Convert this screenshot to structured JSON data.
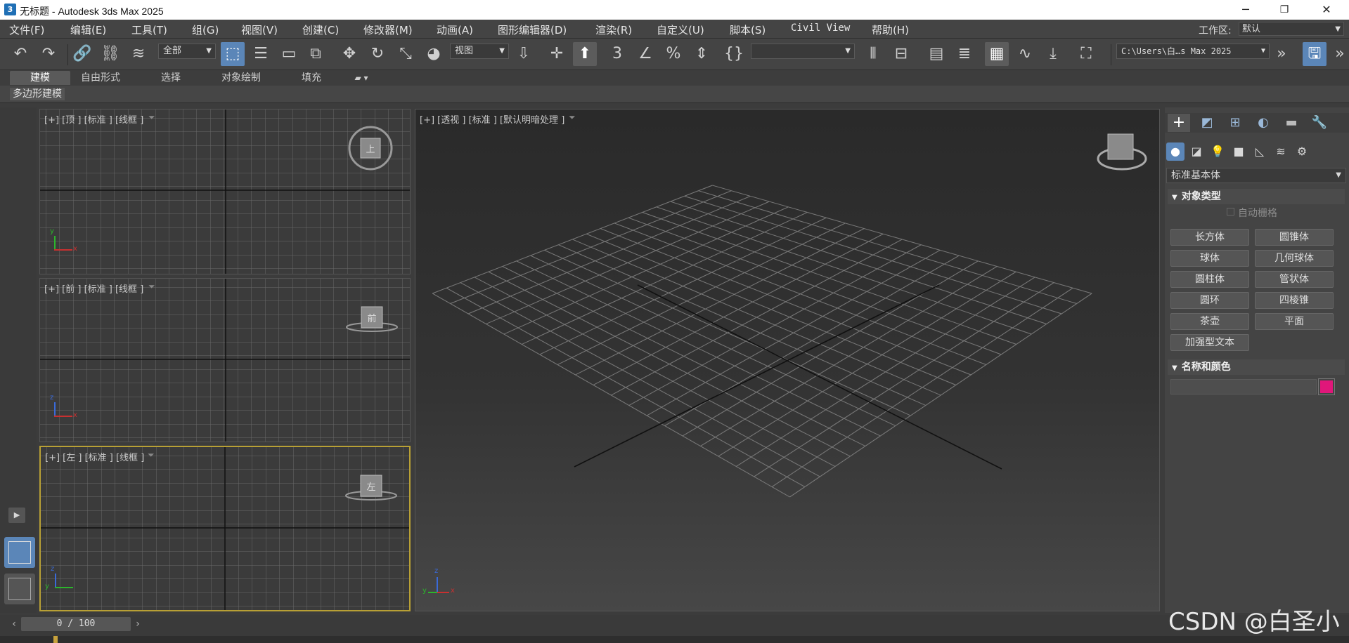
{
  "titlebar": {
    "app_icon_text": "3",
    "title": "无标题 - Autodesk 3ds Max 2025",
    "minimize": "─",
    "restore": "❐",
    "close": "✕"
  },
  "menubar": {
    "items": [
      "文件(F)",
      "编辑(E)",
      "工具(T)",
      "组(G)",
      "视图(V)",
      "创建(C)",
      "修改器(M)",
      "动画(A)",
      "图形编辑器(D)",
      "渲染(R)",
      "自定义(U)",
      "脚本(S)",
      "Civil View",
      "帮助(H)"
    ],
    "workspace_label": "工作区:",
    "workspace_value": "默认"
  },
  "toolbar": {
    "selection_filter": "全部",
    "coord_system": "视图",
    "named_selection": "",
    "project_path": "C:\\Users\\白…s Max 2025"
  },
  "ribbon": {
    "tabs": [
      "建模",
      "自由形式",
      "选择",
      "对象绘制",
      "填充"
    ],
    "selected_tab": "建模",
    "panel_label": "多边形建模"
  },
  "viewports": {
    "top": {
      "label": "[+] [顶 ] [标准 ] [线框 ]",
      "cube_text": "上"
    },
    "front": {
      "label": "[+] [前 ] [标准 ] [线框 ]",
      "cube_text": "前"
    },
    "left": {
      "label": "[+] [左 ] [标准 ] [线框 ]",
      "cube_text": "左"
    },
    "perspective": {
      "label": "[+] [透视 ] [标准 ] [默认明暗处理 ]"
    },
    "axis_x": "x",
    "axis_y": "y",
    "axis_z": "z"
  },
  "command_panel": {
    "category_dropdown": "标准基本体",
    "object_type": {
      "title": "对象类型",
      "autogrid_label": "自动栅格",
      "buttons": [
        "长方体",
        "圆锥体",
        "球体",
        "几何球体",
        "圆柱体",
        "管状体",
        "圆环",
        "四棱锥",
        "茶壶",
        "平面",
        "加强型文本"
      ]
    },
    "name_color": {
      "title": "名称和颜色",
      "name_value": "",
      "color": "#e0177a"
    }
  },
  "timeslider": {
    "frame": "0 / 100"
  },
  "watermark": "CSDN @白圣小",
  "colors": {
    "accent": "#5b86b8",
    "viewport_active_border": "#b8a035",
    "object_color": "#e0177a"
  }
}
